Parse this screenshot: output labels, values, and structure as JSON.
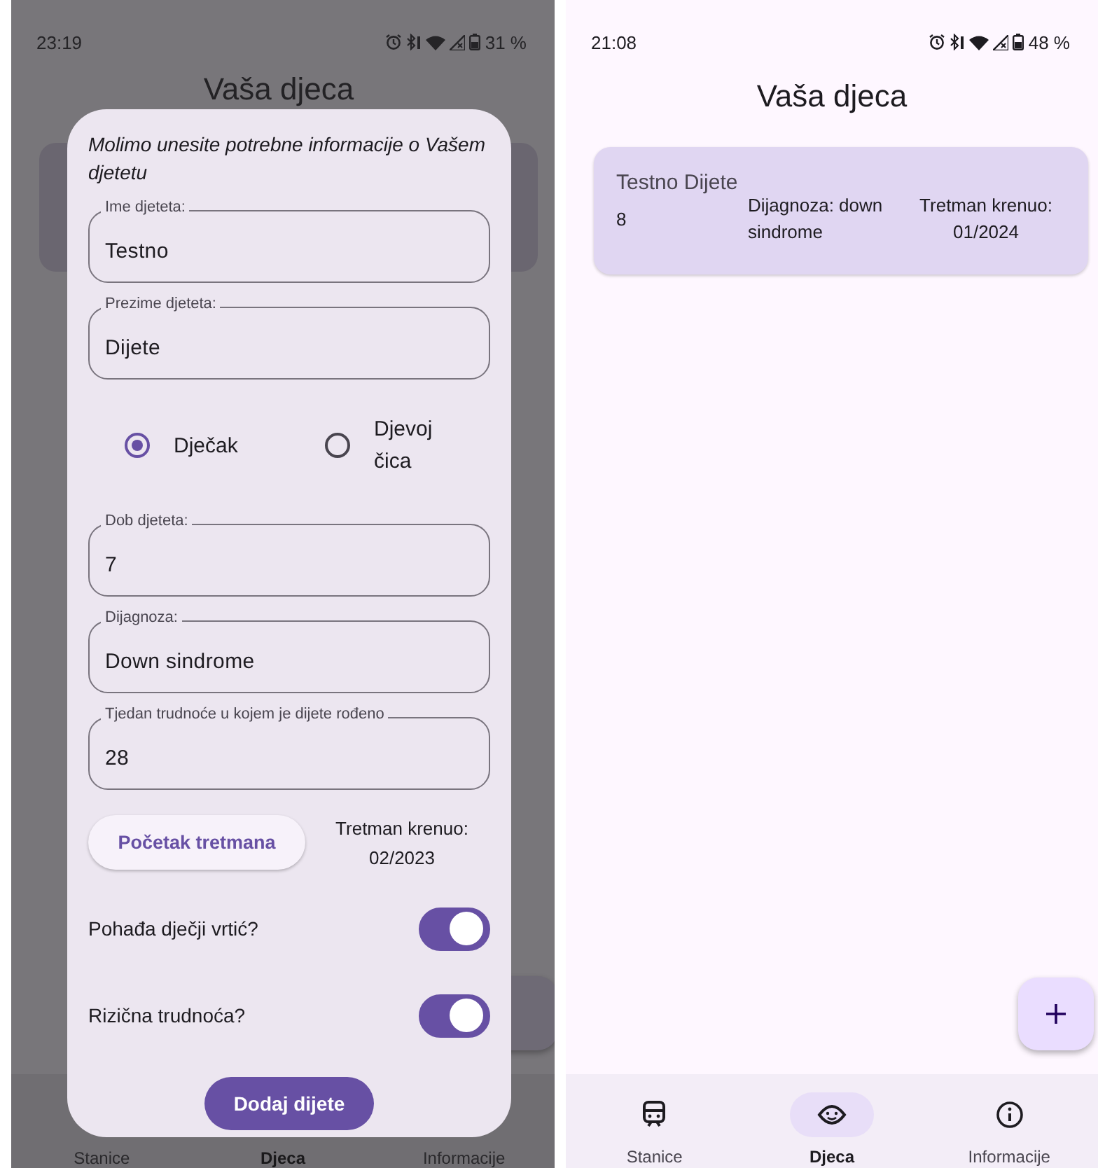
{
  "left_screen": {
    "status_bar": {
      "time": "23:19",
      "battery": "31 %"
    },
    "background": {
      "title": "Vaša djeca",
      "nav": [
        {
          "label": "Stanice",
          "selected": false
        },
        {
          "label": "Djeca",
          "selected": true
        },
        {
          "label": "Informacije",
          "selected": false
        }
      ]
    },
    "dialog": {
      "intro": "Molimo unesite potrebne informacije o Vašem djetetu",
      "fields_top": [
        {
          "label": "Ime djeteta:",
          "value": "Testno"
        },
        {
          "label": "Prezime djeteta:",
          "value": "Dijete"
        }
      ],
      "gender_options": [
        {
          "label": "Dječak",
          "selected": true
        },
        {
          "label": "Djevojčica",
          "selected": false
        }
      ],
      "fields_bottom": [
        {
          "label": "Dob djeteta:",
          "value": "7"
        },
        {
          "label": "Dijagnoza:",
          "value": "Down sindrome"
        },
        {
          "label": "Tjedan trudnoće u kojem je dijete rođeno",
          "value": "28"
        }
      ],
      "treatment": {
        "button": "Početak tretmana",
        "label": "Tretman krenuo:",
        "value": "02/2023"
      },
      "switches": [
        {
          "label": "Pohađa dječji vrtić?",
          "on": true
        },
        {
          "label": "Rizična trudnoća?",
          "on": true
        }
      ],
      "submit": "Dodaj dijete"
    }
  },
  "right_screen": {
    "status_bar": {
      "time": "21:08",
      "battery": "48 %"
    },
    "title": "Vaša djeca",
    "children": [
      {
        "name": "Testno Dijete",
        "age": "8",
        "diagnosis": "Dijagnoza: down sindrome",
        "treatment": "Tretman krenuo: 01/2024"
      }
    ],
    "nav": [
      {
        "label": "Stanice",
        "selected": false
      },
      {
        "label": "Djeca",
        "selected": true
      },
      {
        "label": "Informacije",
        "selected": false
      }
    ]
  }
}
